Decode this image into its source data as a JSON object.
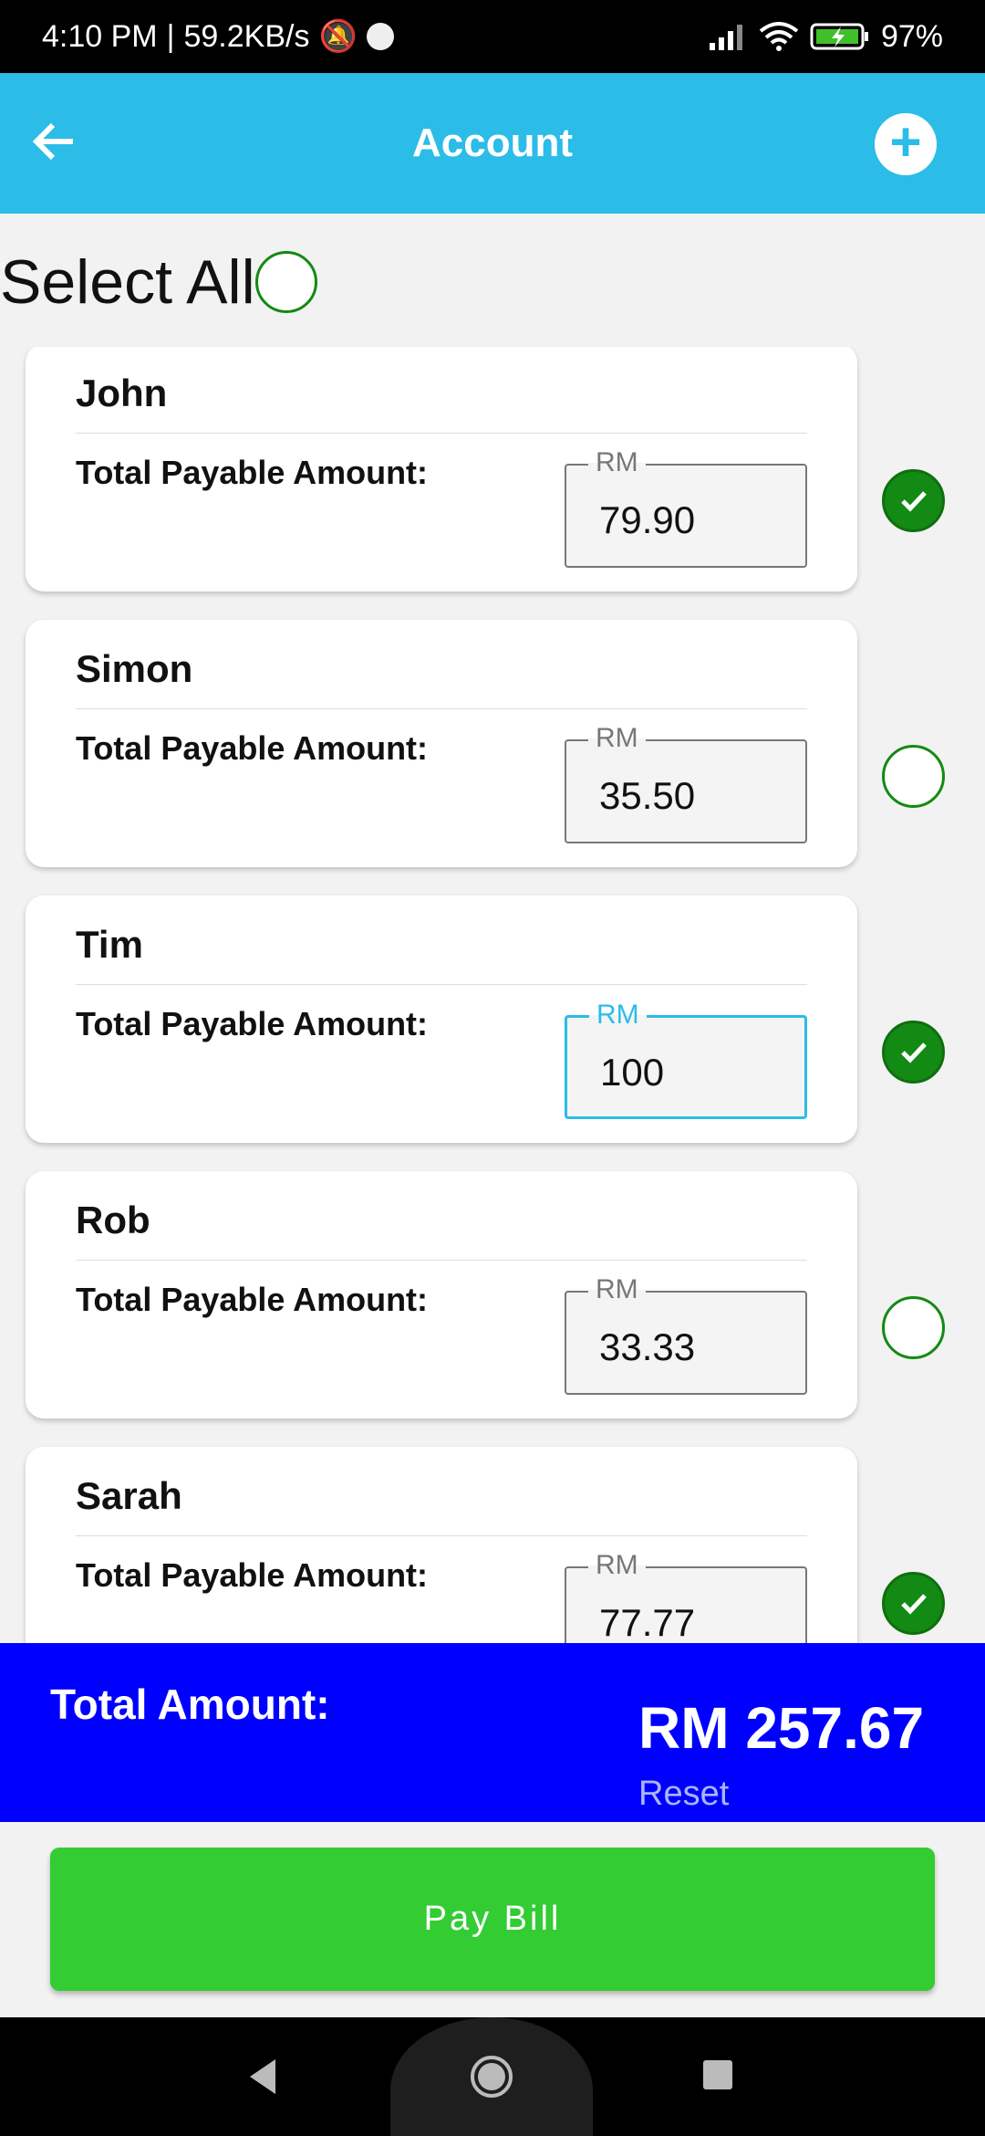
{
  "status_bar": {
    "time": "4:10 PM",
    "speed": "59.2KB/s",
    "battery": "97%"
  },
  "app_bar": {
    "title": "Account",
    "back_icon": "arrow-left-icon",
    "add_icon": "plus-circle-icon"
  },
  "select_all": {
    "label": "Select All",
    "checked": false
  },
  "accounts": [
    {
      "name": "John",
      "label": "Total Payable Amount:",
      "currency": "RM",
      "amount": "79.90",
      "selected": true
    },
    {
      "name": "Simon",
      "label": "Total Payable Amount:",
      "currency": "RM",
      "amount": "35.50",
      "selected": false
    },
    {
      "name": "Tim",
      "label": "Total Payable Amount:",
      "currency": "RM",
      "amount": "100",
      "selected": true,
      "focused": true
    },
    {
      "name": "Rob",
      "label": "Total Payable Amount:",
      "currency": "RM",
      "amount": "33.33",
      "selected": false
    },
    {
      "name": "Sarah",
      "label": "Total Payable Amount:",
      "currency": "RM",
      "amount": "77.77",
      "selected": true
    }
  ],
  "total": {
    "label": "Total Amount:",
    "amount": "RM 257.67",
    "reset": "Reset"
  },
  "pay_button": "Pay Bill",
  "colors": {
    "app_bar": "#2cbce8",
    "total_bar": "#0000ff",
    "pay_button": "#33cc33",
    "check": "#138a13"
  }
}
